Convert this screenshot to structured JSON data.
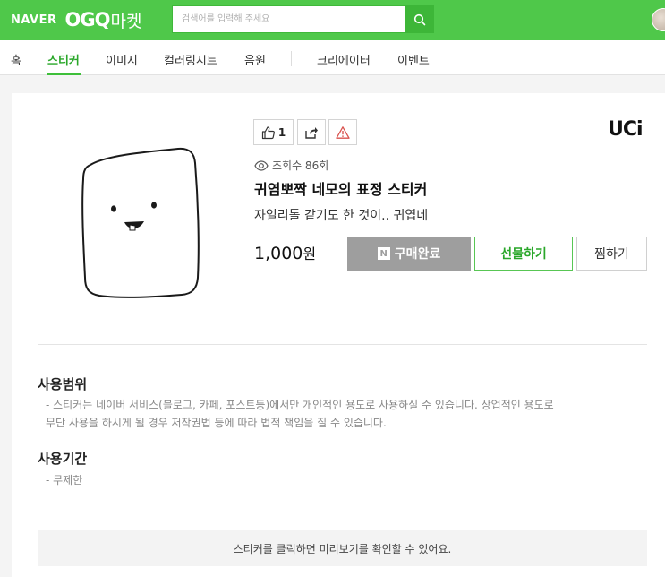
{
  "header": {
    "logo_naver": "NAVER",
    "logo_ogq": "OGQ",
    "logo_market": "마켓",
    "search_placeholder": "검색어를 입력해 주세요",
    "accent_color": "#4fc84a"
  },
  "nav": {
    "items": [
      {
        "label": "홈"
      },
      {
        "label": "스티커"
      },
      {
        "label": "이미지"
      },
      {
        "label": "컬러링시트"
      },
      {
        "label": "음원"
      },
      {
        "label": "크리에이터"
      },
      {
        "label": "이벤트"
      }
    ],
    "active": "스티커"
  },
  "product": {
    "like_count": "1",
    "brand": "UCi",
    "views_label": "조회수 86회",
    "title": "귀염뽀짝 네모의 표정 스티커",
    "description": "자일리톨 같기도 한 것이.. 귀엽네",
    "price": "1,000",
    "price_unit": "원",
    "purchased_badge": "N",
    "purchased_label": "구매완료",
    "gift_label": "선물하기",
    "wish_label": "찜하기"
  },
  "usage": {
    "scope_title": "사용범위",
    "scope_line1": "- 스티커는 네이버 서비스(블로그, 카페, 포스트등)에서만 개인적인 용도로 사용하실 수 있습니다. 상업적인 용도로",
    "scope_line2": "무단 사용을 하시게 될 경우 저작권법 등에 따라 법적 책임을 질 수 있습니다.",
    "period_title": "사용기간",
    "period_text": "- 무제한"
  },
  "notice": "스티커를 클릭하면 미리보기를 확인할 수 있어요."
}
